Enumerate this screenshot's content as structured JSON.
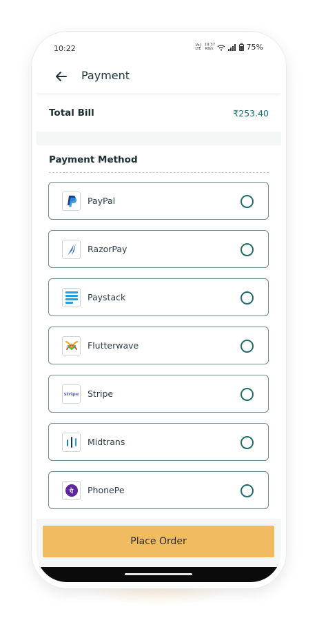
{
  "status_bar": {
    "time": "10:22",
    "network_type": "Vo) LTE",
    "speed_value": "19.37",
    "speed_unit": "KB/s",
    "battery": "75%"
  },
  "header": {
    "title": "Payment"
  },
  "total": {
    "label": "Total Bill",
    "amount": "₹253.40"
  },
  "payment_section": {
    "title": "Payment Method",
    "methods": [
      {
        "label": "PayPal",
        "logo": "paypal-logo-icon"
      },
      {
        "label": "RazorPay",
        "logo": "razorpay-logo-icon"
      },
      {
        "label": "Paystack",
        "logo": "paystack-logo-icon"
      },
      {
        "label": "Flutterwave",
        "logo": "flutterwave-logo-icon"
      },
      {
        "label": "Stripe",
        "logo": "stripe-logo-icon",
        "logo_text": "stripe"
      },
      {
        "label": "Midtrans",
        "logo": "midtrans-logo-icon"
      },
      {
        "label": "PhonePe",
        "logo": "phonepe-logo-icon",
        "logo_text": "पे"
      }
    ]
  },
  "action": {
    "place_order_label": "Place Order"
  },
  "colors": {
    "accent": "#1e6c6a",
    "button": "#f1bc61",
    "card_border": "#6f8a8d"
  }
}
